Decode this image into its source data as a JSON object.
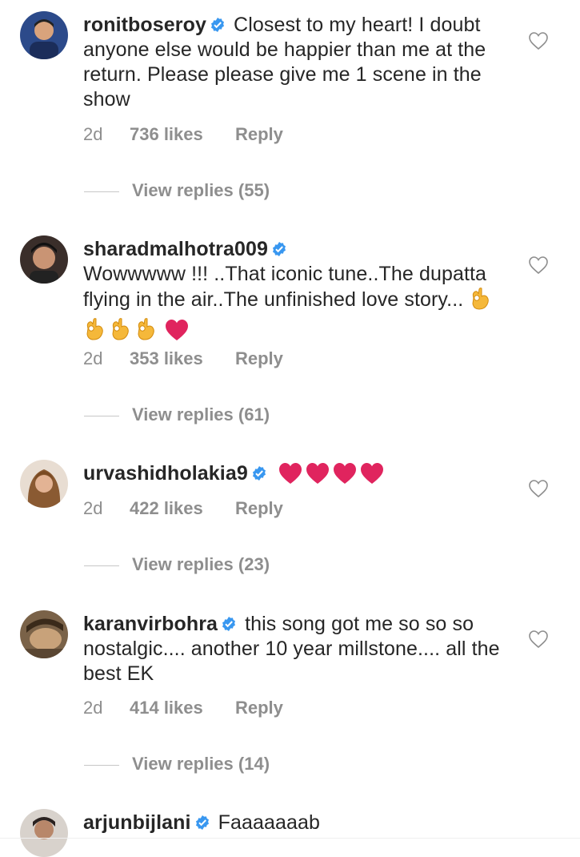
{
  "colors": {
    "verified": "#3897f0",
    "text": "#262626",
    "secondary": "#8e8e8e",
    "heart_emoji": "#e0245e",
    "ok_hand_emoji": "#f5b83a"
  },
  "comments": [
    {
      "username": "ronitboseroy",
      "verified": true,
      "text": "Closest to my heart! I doubt anyone else would be happier than me at the return. Please please give me 1 scene in the show",
      "emojis": [],
      "time": "2d",
      "likes": "736 likes",
      "reply_label": "Reply",
      "view_replies": "View replies (55)"
    },
    {
      "username": "sharadmalhotra009",
      "verified": true,
      "text": "Wowwwww !!! ..That iconic tune..The dupatta flying in the air..The unfinished love story...",
      "emojis": [
        "ok-hand",
        "ok-hand",
        "ok-hand",
        "ok-hand",
        "red-heart"
      ],
      "time": "2d",
      "likes": "353 likes",
      "reply_label": "Reply",
      "view_replies": "View replies (61)"
    },
    {
      "username": "urvashidholakia9",
      "verified": true,
      "text": "",
      "emojis": [
        "red-heart",
        "red-heart",
        "red-heart",
        "red-heart"
      ],
      "time": "2d",
      "likes": "422 likes",
      "reply_label": "Reply",
      "view_replies": "View replies (23)"
    },
    {
      "username": "karanvirbohra",
      "verified": true,
      "text": "this song got me so so so nostalgic.... another 10 year millstone.... all the best EK",
      "emojis": [],
      "time": "2d",
      "likes": "414 likes",
      "reply_label": "Reply",
      "view_replies": "View replies (14)"
    },
    {
      "username": "arjunbijlani",
      "verified": true,
      "text": "Faaaaaaab",
      "emojis": []
    }
  ]
}
